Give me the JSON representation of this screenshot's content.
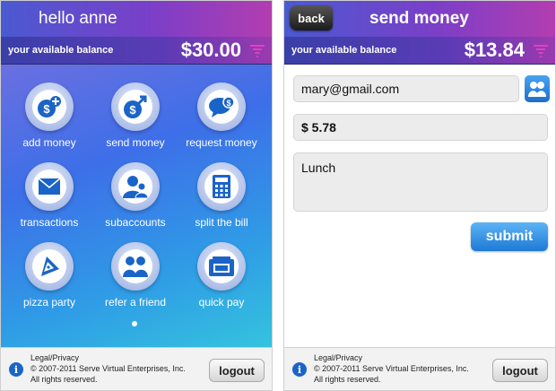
{
  "home": {
    "title": "hello anne",
    "balance_label": "your available balance",
    "balance_amount": "$30.00",
    "items": [
      {
        "label": "add money",
        "icon": "add-money-icon"
      },
      {
        "label": "send money",
        "icon": "send-money-icon"
      },
      {
        "label": "request money",
        "icon": "request-money-icon"
      },
      {
        "label": "transactions",
        "icon": "envelope-icon"
      },
      {
        "label": "subaccounts",
        "icon": "people-icon"
      },
      {
        "label": "split the bill",
        "icon": "calculator-icon"
      },
      {
        "label": "pizza party",
        "icon": "pizza-icon"
      },
      {
        "label": "refer a friend",
        "icon": "friends-icon"
      },
      {
        "label": "quick pay",
        "icon": "wallet-icon"
      }
    ]
  },
  "send": {
    "back_label": "back",
    "title": "send money",
    "balance_label": "your available balance",
    "balance_amount": "$13.84",
    "email_value": "mary@gmail.com",
    "amount_value": "$ 5.78",
    "memo_value": "Lunch",
    "submit_label": "submit"
  },
  "footer": {
    "legal_link": "Legal/Privacy",
    "copyright": "© 2007-2011 Serve Virtual Enterprises, Inc.",
    "rights": "All rights reserved.",
    "logout_label": "logout",
    "info_glyph": "i"
  },
  "colors": {
    "header_start": "#4a5ad1",
    "header_end": "#b33db0",
    "icon_blue": "#1a64c8",
    "submit_blue": "#1e7ad6"
  }
}
